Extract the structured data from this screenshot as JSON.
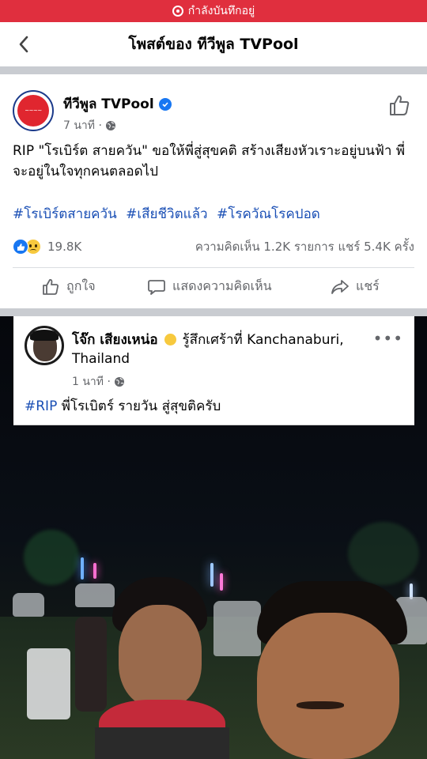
{
  "status_bar": {
    "recording_label": "กำลังบันทึกอยู่"
  },
  "nav": {
    "title": "โพสต์ของ ทีวีพูล TVPool"
  },
  "post": {
    "page_name": "ทีวีพูล TVPool",
    "time": "7 นาที ·",
    "text": "RIP \"โรเบิร์ต สายควัน\" ขอให้พี่สู่สุขคติ สร้างเสียงหัวเราะอยู่บนฟ้า พี่จะอยู่ในใจทุกคนตลอดไป",
    "hashtags": [
      "#โรเบิร์ตสายควัน",
      "#เสียชีวิตแล้ว",
      "#โรควัณโรคปอด"
    ],
    "reaction_count": "19.8K",
    "comments_shares": "ความคิดเห็น 1.2K รายการ  แชร์ 5.4K ครั้ง",
    "actions": {
      "like": "ถูกใจ",
      "comment": "แสดงความคิดเห็น",
      "share": "แชร์"
    }
  },
  "shared": {
    "author": "โจ๊ก เสียงเหน่อ",
    "feeling": "รู้สึกเศร้าที่ Kanchanaburi, Thailand",
    "time": "1 นาที ·",
    "more": "•••",
    "tag": "#RIP",
    "text": "พี่โรเบิตร์ รายวัน สู่สุขติครับ"
  },
  "colors": {
    "accent": "#1877f2",
    "hashtag": "#1a4fb5",
    "recording": "#e02f3e"
  }
}
